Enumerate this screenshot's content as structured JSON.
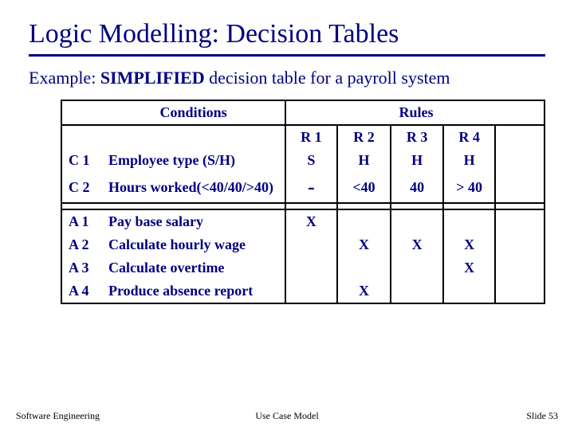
{
  "title": "Logic Modelling: Decision Tables",
  "subtitle": {
    "lead": "Example:",
    "emph": "SIMPLIFIED",
    "tail": " decision table for a payroll system"
  },
  "table": {
    "conditions_header": "Conditions",
    "rules_header": "Rules",
    "rules": [
      "R 1",
      "R 2",
      "R 3",
      "R 4"
    ],
    "conditions": [
      {
        "id": "C 1",
        "label": "Employee type (S/H)",
        "vals": [
          "S",
          "H",
          "H",
          "H"
        ]
      },
      {
        "id": "C 2",
        "label": "Hours worked(<40/40/>40)",
        "vals": [
          "-",
          "<40",
          "40",
          "> 40"
        ]
      }
    ],
    "actions": [
      {
        "id": "A 1",
        "label": "Pay base salary",
        "vals": [
          "X",
          "",
          "",
          ""
        ]
      },
      {
        "id": "A 2",
        "label": "Calculate hourly wage",
        "vals": [
          "",
          "X",
          "X",
          "X"
        ]
      },
      {
        "id": "A 3",
        "label": "Calculate overtime",
        "vals": [
          "",
          "",
          "",
          "X"
        ]
      },
      {
        "id": "A 4",
        "label": "Produce absence report",
        "vals": [
          "",
          "X",
          "",
          ""
        ]
      }
    ]
  },
  "footer": {
    "left": "Software Engineering",
    "center": "Use Case Model",
    "right": "Slide  53"
  }
}
